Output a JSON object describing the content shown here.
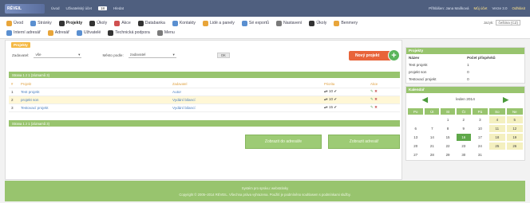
{
  "topbar": {
    "logo": "RÉVEIL",
    "home": "Úvod",
    "account_label": "Uživatelský účet",
    "account_value": "18",
    "search_label": "Hledat",
    "login_info": "Přihlášen: Jana Malíková",
    "my_account": "Můj účet",
    "version": "Verze 3.0",
    "logout": "Odhlásit"
  },
  "menu": {
    "row1": [
      "Úvod",
      "Stránky",
      "Projekty",
      "Úkoly",
      "Akce",
      "Databanka",
      "Kontakty",
      "Lidé a panely",
      "Sé exportů",
      "Nastavení",
      "Úkoly",
      "Benmery"
    ],
    "row2": [
      "Interní adresář",
      "Adresář",
      "Uživatelé",
      "Technická podpora",
      "Menu"
    ],
    "active": "Projekty",
    "lang_label": "Jazyk:",
    "lang_value": "čeština (CZ)"
  },
  "filters": {
    "section_button": "Projekty",
    "zadavatel_label": "Zadavatel:",
    "zadavatel_value": "vše",
    "mesto_label": "Město podle:",
    "mesto_value": "zadavatel",
    "ok": "OK",
    "new_project": "Nový projekt"
  },
  "list": {
    "bar_top": "Strana 1 z 1 (záznamů 3)",
    "bar_bottom": "Strana 1 z 1 (záznamů 3)",
    "headers": [
      "#",
      "Projekt",
      "Zadavatel",
      "Priorita",
      "Akce"
    ],
    "rows": [
      {
        "n": "1",
        "name": "Test projekt",
        "client": "Autor",
        "prio": "10"
      },
      {
        "n": "2",
        "name": "projekt son",
        "client": "Vydání bilancí",
        "prio": "10"
      },
      {
        "n": "3",
        "name": "Testovací projekt",
        "client": "Vydání bilancí",
        "prio": "15"
      }
    ],
    "btn_left": "Zobrazit do adresáře",
    "btn_right": "Zobrazit adresář"
  },
  "sidebar": {
    "projects_title": "Projekty",
    "col_name": "Název",
    "col_count": "Počet příspěvků",
    "projects": [
      {
        "name": "Test projekt",
        "count": "1"
      },
      {
        "name": "projekt son",
        "count": "0"
      },
      {
        "name": "Testovací projekt",
        "count": "0"
      }
    ],
    "calendar_title": "Kalendář",
    "month": "leden 2014",
    "days": [
      "Po",
      "Út",
      "St",
      "Čt",
      "Pá",
      "So",
      "Ne"
    ],
    "weeks": [
      [
        "",
        "",
        "1",
        "2",
        "3",
        "4",
        "5"
      ],
      [
        "6",
        "7",
        "8",
        "9",
        "10",
        "11",
        "12"
      ],
      [
        "13",
        "14",
        "15",
        "16",
        "17",
        "18",
        "19"
      ],
      [
        "20",
        "21",
        "22",
        "23",
        "24",
        "25",
        "26"
      ],
      [
        "27",
        "28",
        "29",
        "30",
        "31",
        "",
        ""
      ]
    ],
    "today": "16"
  },
  "footer": {
    "line1": "Systém pro správu: webstránky",
    "line2": "Copyright © 2005–2014 RÉVEIL. Všechna práva vyhrazena. Použití je podmíněno souhlasem s podmínkami služby."
  }
}
